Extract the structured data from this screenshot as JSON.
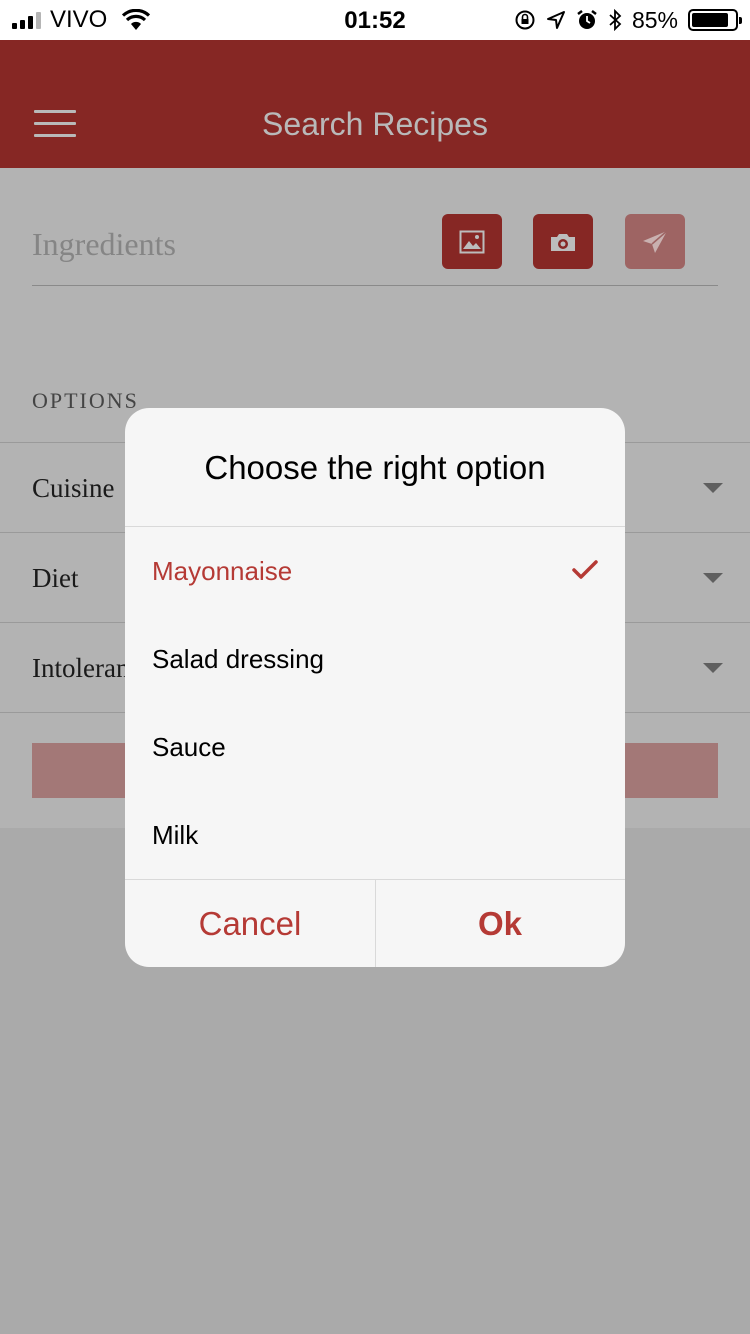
{
  "status_bar": {
    "carrier": "VIVO",
    "time": "01:52",
    "battery_percent": "85%",
    "icons": [
      "signal-icon",
      "wifi-icon",
      "rotation-lock-icon",
      "location-icon",
      "alarm-icon",
      "bluetooth-icon",
      "battery-icon"
    ]
  },
  "header": {
    "title": "Search Recipes",
    "menu_icon": "hamburger-menu-icon"
  },
  "search": {
    "placeholder": "Ingredients",
    "buttons": [
      "image-icon",
      "camera-icon",
      "send-icon"
    ]
  },
  "options": {
    "heading": "OPTIONS",
    "rows": [
      {
        "label": "Cuisine"
      },
      {
        "label": "Diet"
      },
      {
        "label": "Intoleran"
      }
    ]
  },
  "dialog": {
    "title": "Choose the right option",
    "items": [
      {
        "label": "Mayonnaise",
        "selected": true
      },
      {
        "label": "Salad dressing",
        "selected": false
      },
      {
        "label": "Sauce",
        "selected": false
      },
      {
        "label": "Milk",
        "selected": false
      }
    ],
    "cancel_label": "Cancel",
    "ok_label": "Ok"
  },
  "colors": {
    "brand": "#862724",
    "accent": "#b53a35",
    "overlay": "#aaaaaa"
  }
}
